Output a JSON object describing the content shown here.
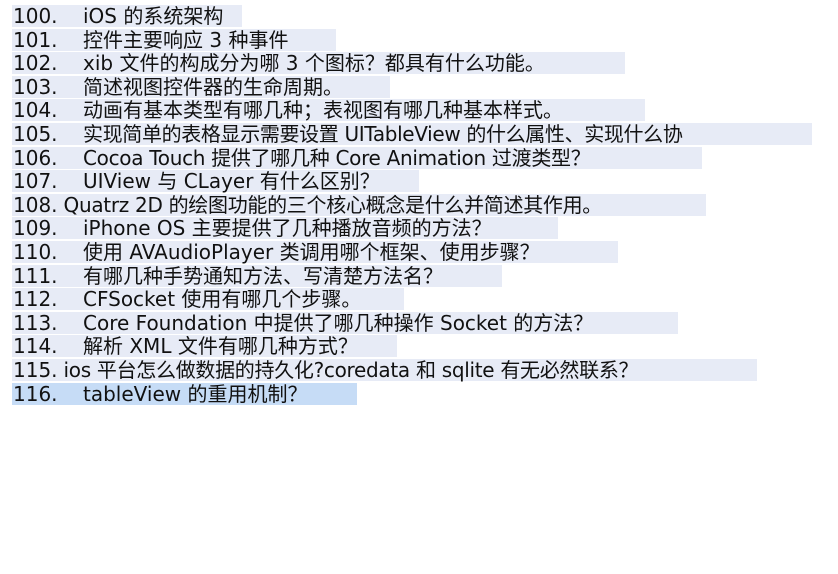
{
  "items": [
    {
      "num": "100.",
      "text": "iOS 的系统架构"
    },
    {
      "num": "101.",
      "text": "控件主要响应 3 种事件"
    },
    {
      "num": "102.",
      "text": "xib 文件的构成分为哪 3 个图标？都具有什么功能。"
    },
    {
      "num": "103.",
      "text": "简述视图控件器的生命周期。"
    },
    {
      "num": "104.",
      "text": "动画有基本类型有哪几种；表视图有哪几种基本样式。"
    },
    {
      "num": "105.",
      "text": "实现简单的表格显示需要设置 UITableView 的什么属性、实现什么协"
    },
    {
      "num": "106.",
      "text": "Cocoa Touch 提供了哪几种 Core Animation 过渡类型？"
    },
    {
      "num": "107.",
      "text": "UIView 与 CLayer 有什么区别？"
    },
    {
      "num": "108.",
      "text": "Quatrz 2D 的绘图功能的三个核心概念是什么并简述其作用。"
    },
    {
      "num": "109.",
      "text": "iPhone OS 主要提供了几种播放音频的方法？"
    },
    {
      "num": "110.",
      "text": "使用 AVAudioPlayer 类调用哪个框架、使用步骤？"
    },
    {
      "num": "111.",
      "text": "有哪几种手势通知方法、写清楚方法名？"
    },
    {
      "num": "112.",
      "text": "CFSocket 使用有哪几个步骤。"
    },
    {
      "num": "113.",
      "text": "Core Foundation 中提供了哪几种操作 Socket 的方法？"
    },
    {
      "num": "114.",
      "text": "解析 XML 文件有哪几种方式？"
    },
    {
      "num": "115.",
      "text": "ios  平台怎么做数据的持久化?coredata  和 sqlite 有无必然联系？"
    },
    {
      "num": "116.",
      "text": "tableView  的重用机制？"
    }
  ],
  "colors": {
    "row_highlight": "#e7ebf6",
    "selection": "#c6dcf6",
    "text": "#111111"
  }
}
